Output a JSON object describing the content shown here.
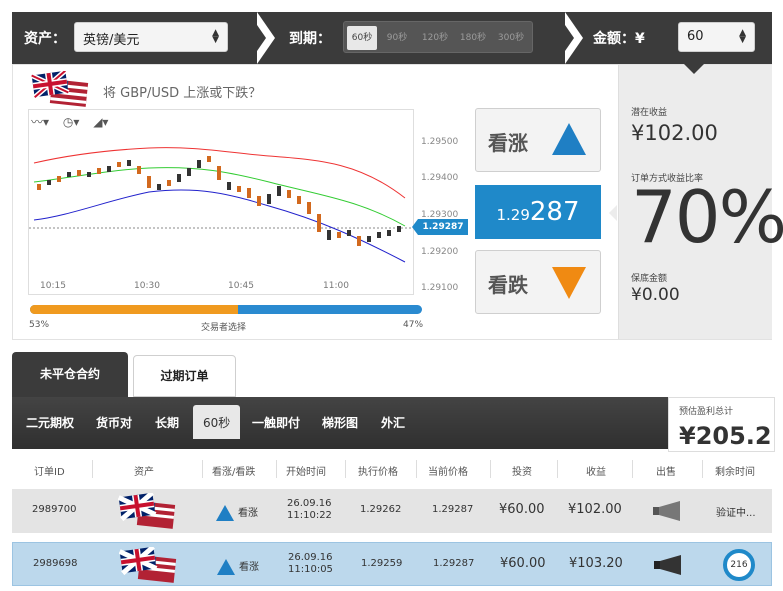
{
  "topbar": {
    "asset_label": "资产：",
    "asset_value": "英镑/美元",
    "expiry_label": "到期：",
    "expiry_options": [
      "60秒",
      "90秒",
      "120秒",
      "180秒",
      "300秒"
    ],
    "expiry_selected": "60秒",
    "amount_label": "金额：¥",
    "amount_value": "60"
  },
  "trade": {
    "question": "将 GBP/USD 上涨或下跌？",
    "up_label": "看涨",
    "down_label": "看跌",
    "price_prefix": "1.29",
    "price_suffix": "287",
    "price_tag": "1.29287",
    "y_ticks": [
      "1.29500",
      "1.29400",
      "1.29300",
      "1.29200",
      "1.29100"
    ],
    "x_ticks": [
      "10:15",
      "10:30",
      "10:45",
      "11:00"
    ],
    "sentiment_left": "53%",
    "sentiment_label": "交易者选择",
    "sentiment_right": "47%",
    "sentiment_fill": 0.53
  },
  "summary": {
    "potential_label": "潜在收益",
    "potential_value": "¥102.00",
    "payout_label": "订单方式收益比率",
    "payout_value": "70%",
    "insurance_label": "保底金额",
    "insurance_value": "¥0.00"
  },
  "tabs": {
    "open": "未平仓合约",
    "expired": "过期订单"
  },
  "subtabs": [
    "二元期权",
    "货币对",
    "长期",
    "60秒",
    "一触即付",
    "梯形图",
    "外汇"
  ],
  "estimate": {
    "label": "预估盈利总计",
    "value": "¥205.2"
  },
  "table": {
    "headers": [
      "订单ID",
      "资产",
      "看涨/看跌",
      "开始时间",
      "执行价格",
      "当前价格",
      "投资",
      "收益",
      "出售",
      "剩余时间"
    ],
    "rows": [
      {
        "id": "2989700",
        "direction": "看涨",
        "date": "26.09.16",
        "time": "11:10:22",
        "strike": "1.29262",
        "current": "1.29287",
        "investment": "¥60.00",
        "payout": "¥102.00",
        "remaining": "验证中..."
      },
      {
        "id": "2989698",
        "direction": "看涨",
        "date": "26.09.16",
        "time": "11:10:05",
        "strike": "1.29259",
        "current": "1.29287",
        "investment": "¥60.00",
        "payout": "¥103.20",
        "remaining": "216"
      }
    ]
  }
}
